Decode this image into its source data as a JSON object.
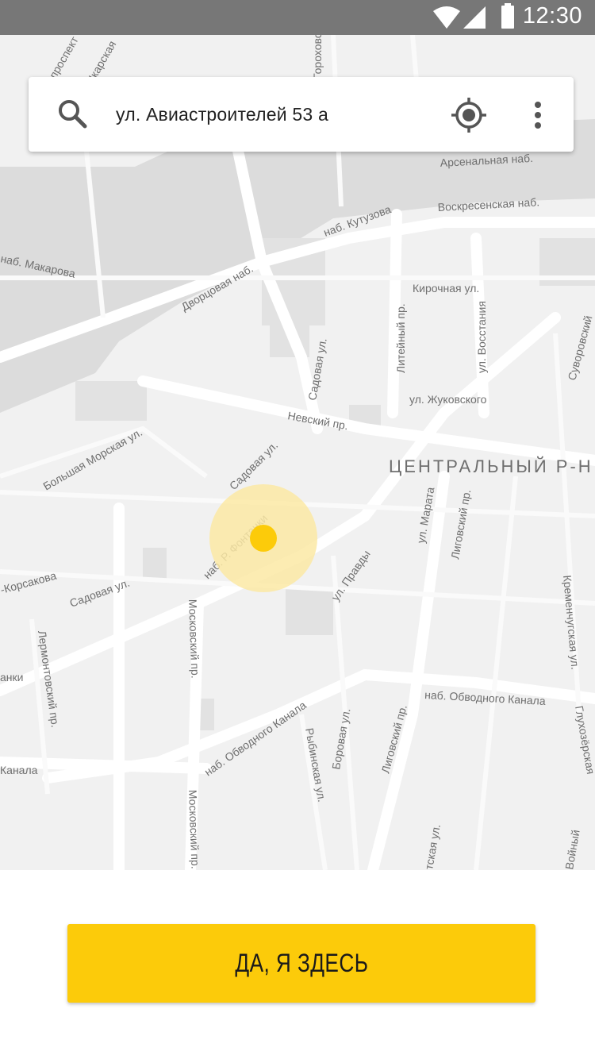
{
  "status_bar": {
    "time": "12:30",
    "icons": [
      "wifi-icon",
      "signal-icon",
      "battery-icon"
    ]
  },
  "search": {
    "address": "ул. Авиастроителей 53 а",
    "icons": [
      "search-icon",
      "my-location-icon",
      "more-vert-icon"
    ]
  },
  "map": {
    "district_label": "ЦЕНТРАЛЬНЫЙ Р-Н",
    "street_labels": [
      "проспект",
      "Шкарская",
      "Гороховская",
      "Арсенальная наб.",
      "Воскресенская наб.",
      "наб. Кутузова",
      "наб. Макарова",
      "Дворцовая наб.",
      "Кирочная ул.",
      "Литейный пр.",
      "ул. Восстания",
      "Садовая ул.",
      "ул. Жуковского",
      "Невский пр.",
      "Большая Морская ул.",
      "Садовая ул.",
      "наб. Р. Фонтанки",
      "ул. Марата",
      "Лиговский пр.",
      "-Корсакова",
      "Садовая ул.",
      "Московский пр.",
      "ул. Правды",
      "Кременчугская ул.",
      "Лермонтовский пр.",
      "анки",
      "наб. Обводного Канала",
      "Боровая ул.",
      "Лиговский пр.",
      "Глухозёрская",
      "Рыбинская ул.",
      "наб. Обводного Канала",
      "Канала",
      "Московский пр.",
      "тская ул.",
      "Суворовский",
      "Войный"
    ],
    "accent_color": "#fccb0a",
    "marker_halo_color": "#fbe9a4"
  },
  "confirm_button": {
    "label": "ДА, Я ЗДЕСЬ"
  }
}
